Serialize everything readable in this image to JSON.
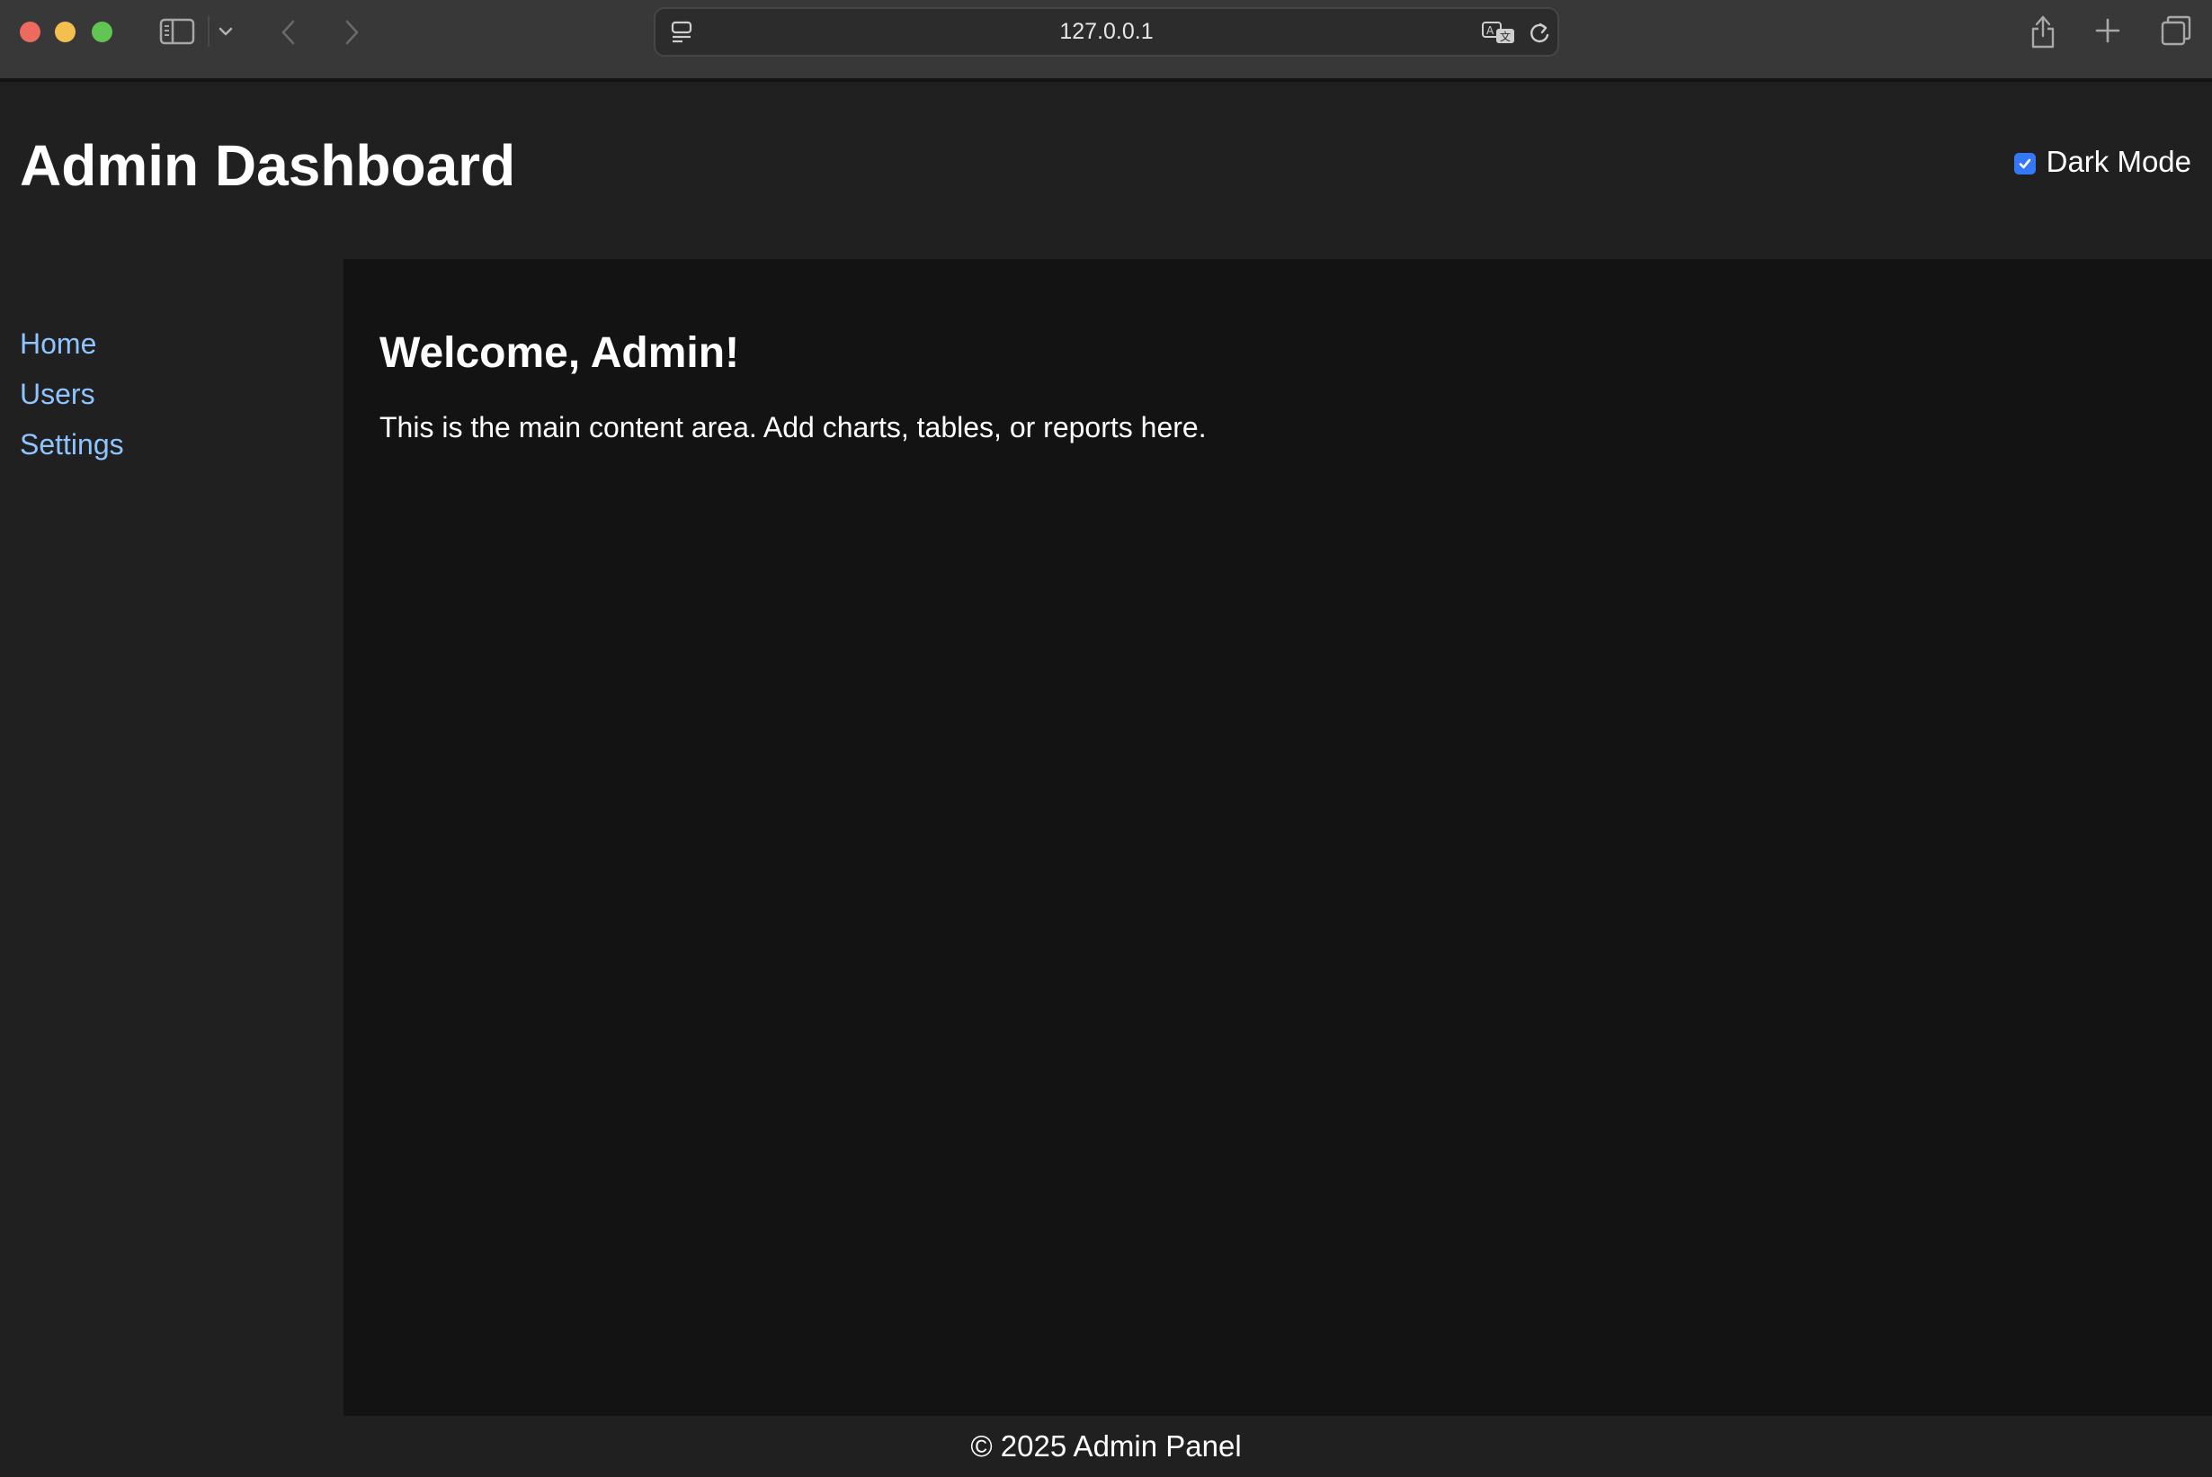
{
  "browser": {
    "url": "127.0.0.1",
    "icons": {
      "sidebar_toggle": "sidebar-icon",
      "sidebar_menu": "chevron-down-icon",
      "back": "chevron-left-icon",
      "forward": "chevron-right-icon",
      "site": "page-menu-icon",
      "translate": "translate-icon",
      "reload": "reload-icon",
      "share": "share-icon",
      "new_tab": "plus-icon",
      "tab_overview": "tabs-icon"
    }
  },
  "header": {
    "title": "Admin Dashboard",
    "dark_mode_label": "Dark Mode",
    "dark_mode_checked": true
  },
  "sidebar": {
    "items": [
      {
        "label": "Home"
      },
      {
        "label": "Users"
      },
      {
        "label": "Settings"
      }
    ]
  },
  "main": {
    "heading": "Welcome, Admin!",
    "text": "This is the main content area. Add charts, tables, or reports here."
  },
  "footer": {
    "text": "© 2025 Admin Panel"
  },
  "colors": {
    "link": "#8ec5ff",
    "accent": "#3478f6",
    "header_bg": "#202020",
    "main_bg": "#131313"
  }
}
